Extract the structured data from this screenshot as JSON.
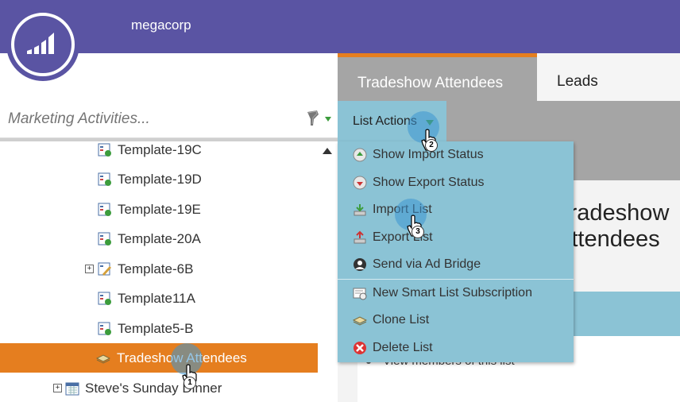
{
  "header": {
    "org_name": "megacorp"
  },
  "search": {
    "placeholder": "Marketing Activities..."
  },
  "tree": {
    "items": [
      {
        "label": "Template-19C",
        "icon": "program-icon"
      },
      {
        "label": "Template-19D",
        "icon": "program-icon"
      },
      {
        "label": "Template-19E",
        "icon": "program-icon"
      },
      {
        "label": "Template-20A",
        "icon": "program-icon"
      },
      {
        "label": "Template-6B",
        "icon": "edit-program-icon"
      },
      {
        "label": "Template11A",
        "icon": "program-icon"
      },
      {
        "label": "Template5-B",
        "icon": "program-icon"
      },
      {
        "label": "Tradeshow Attendees",
        "icon": "list-icon"
      },
      {
        "label": "Steve's Sunday Dinner",
        "icon": "calendar-icon"
      }
    ]
  },
  "tabs": {
    "active": "Tradeshow Attendees",
    "leads": "Leads"
  },
  "toolbar": {
    "list_actions": "List Actions"
  },
  "page": {
    "heading": "Tradeshow Attendees",
    "panel_text": "View members of this list"
  },
  "menu": {
    "items": [
      {
        "label": "Show Import Status",
        "icon": "import-status-icon"
      },
      {
        "label": "Show Export Status",
        "icon": "export-status-icon"
      },
      {
        "label": "Import List",
        "icon": "import-icon"
      },
      {
        "label": "Export List",
        "icon": "export-icon"
      },
      {
        "label": "Send via Ad Bridge",
        "icon": "ad-bridge-icon"
      },
      {
        "label": "New Smart List Subscription",
        "icon": "subscription-icon"
      },
      {
        "label": "Clone List",
        "icon": "clone-icon"
      },
      {
        "label": "Delete List",
        "icon": "delete-icon"
      }
    ]
  },
  "steps": [
    "1",
    "2",
    "3"
  ],
  "colors": {
    "header": "#5a54a3",
    "accent": "#e57e1f",
    "menu": "#8bc3d5",
    "toolbar": "#a5a5a5"
  }
}
